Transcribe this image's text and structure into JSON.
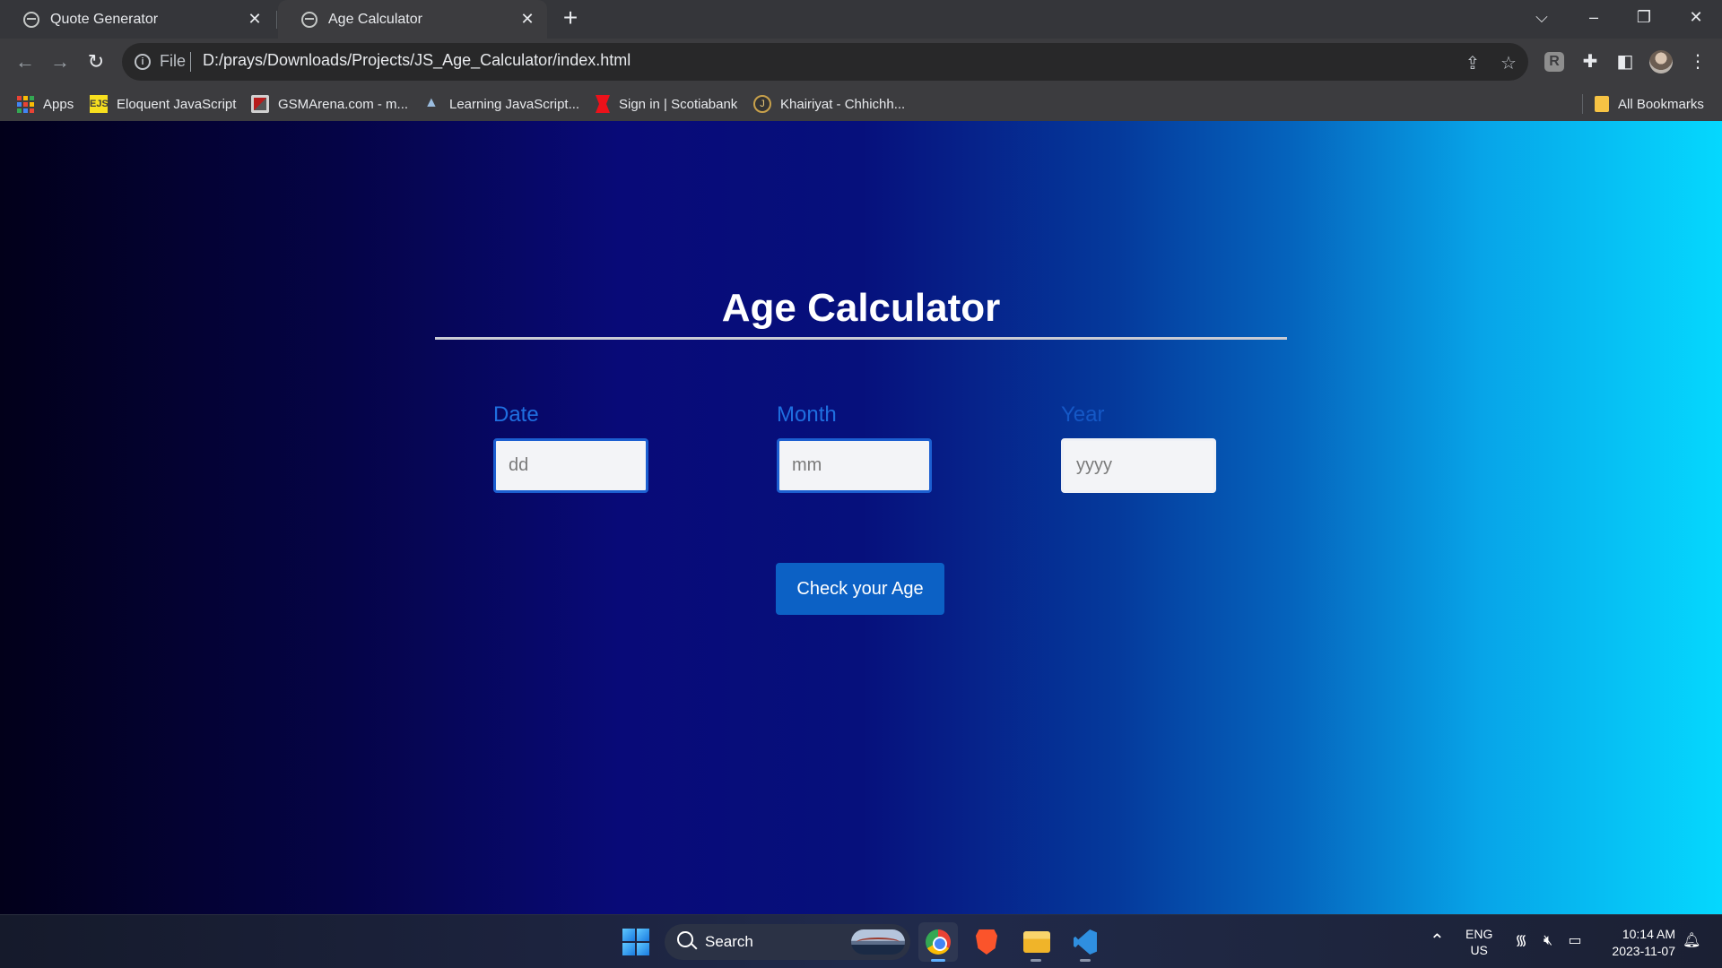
{
  "browser": {
    "tabs": [
      {
        "label": "Quote Generator",
        "active": false
      },
      {
        "label": "Age Calculator",
        "active": true
      }
    ],
    "new_tab_symbol": "+",
    "toolbar": {
      "scheme_label": "File",
      "url": "D:/prays/Downloads/Projects/JS_Age_Calculator/index.html"
    },
    "bookmarks": [
      {
        "label": "Apps",
        "icon": "apps-grid-icon"
      },
      {
        "label": "Eloquent JavaScript",
        "icon": "ejs-icon"
      },
      {
        "label": "GSMArena.com - m...",
        "icon": "gsmarena-icon"
      },
      {
        "label": "Learning JavaScript...",
        "icon": "learning-js-icon"
      },
      {
        "label": "Sign in | Scotiabank",
        "icon": "scotiabank-icon"
      },
      {
        "label": "Khairiyat - Chhichh...",
        "icon": "khairiyat-icon"
      }
    ],
    "all_bookmarks_label": "All Bookmarks"
  },
  "page": {
    "title": "Age Calculator",
    "fields": {
      "date": {
        "label": "Date",
        "placeholder": "dd",
        "value": ""
      },
      "month": {
        "label": "Month",
        "placeholder": "mm",
        "value": ""
      },
      "year": {
        "label": "Year",
        "placeholder": "yyyy",
        "value": ""
      }
    },
    "check_button": "Check your Age",
    "colors": {
      "background_gradient": [
        "#02001a",
        "#080a78",
        "#05d8fe"
      ],
      "label_color": "#1f6fe0",
      "button_color": "#0c61c5"
    }
  },
  "taskbar": {
    "search_label": "Search",
    "pinned_apps": [
      "chrome-icon",
      "brave-icon",
      "file-explorer-icon",
      "vscode-icon"
    ],
    "language_line1": "ENG",
    "language_line2": "US",
    "time": "10:14 AM",
    "date": "2023-11-07"
  }
}
